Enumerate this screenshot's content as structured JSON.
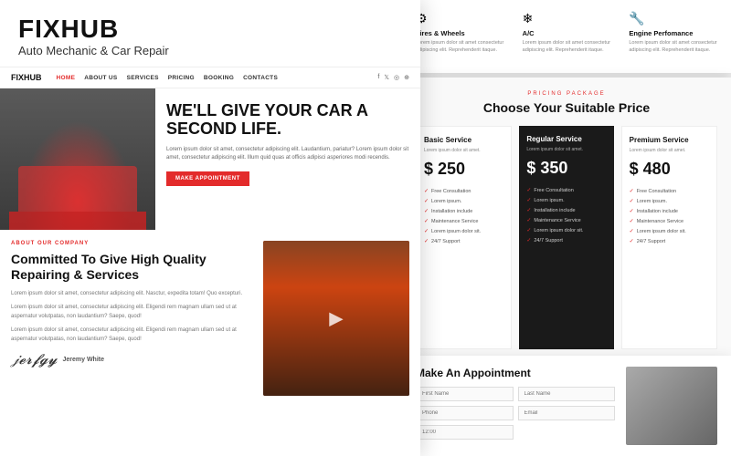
{
  "brand": {
    "title": "FIXHUB",
    "subtitle": "Auto Mechanic & Car Repair"
  },
  "nav": {
    "logo": "FIXHUB",
    "items": [
      "HOME",
      "ABOUT US",
      "SERVICES",
      "PRICING",
      "BOOKING",
      "CONTACTS"
    ]
  },
  "hero": {
    "headline": "WE'LL GIVE YOUR CAR A SECOND LIFE.",
    "description": "Lorem ipsum dolor sit amet, consectetur adipiscing elit. Laudantium, pariatur? Lorem ipsum dolor sit amet, consectetur adipiscing elit. Illum quid quas at officis adipisci asperiores modi recendis.",
    "button_label": "MAKE APPOINTMENT"
  },
  "about": {
    "label": "ABOUT OUR COMPANY",
    "title": "Committed To Give High Quality Repairing & Services",
    "desc1": "Lorem ipsum dolor sit amet, consectetur adipiscing elit. Nasctur, expedita totam! Quo excepturi.",
    "desc2": "Lorem ipsum dolor sit amet, consectetur adipiscing elit. Eligendi rem magnam ullam sed ut at aspernatur volutpatas, non laudantium? Saepe, quod!",
    "desc3": "Lorem ipsum dolor sit amet, consectetur adipiscing elit. Eligendi rem magnam ullam sed ut at aspernatur volutpatas, non laudantium? Saepe, quod!",
    "signature": "Jeremy White",
    "signature_script": "Jeremy White"
  },
  "services": [
    {
      "icon": "⚙",
      "name": "Tires & Wheels",
      "desc": "Lorem ipsum dolor sit amet consectetur adipiscing elit. Reprehenderit itaque."
    },
    {
      "icon": "❄",
      "name": "A/C",
      "desc": "Lorem ipsum dolor sit amet consectetur adipiscing elit. Reprehenderit itaque."
    },
    {
      "icon": "🔧",
      "name": "Engine Perfomance",
      "desc": "Lorem ipsum dolor sit amet consectetur adipiscing elit. Reprehenderit itaque."
    }
  ],
  "pricing": {
    "label": "PRICING PACKAGE",
    "title": "Choose Your Suitable Price",
    "plans": [
      {
        "name": "Basic Service",
        "price": "$ 250",
        "desc": "Lorem ipsum dolor sit amet.",
        "featured": false,
        "features": [
          "Free Consultation",
          "Lorem ipsum.",
          "Installation include",
          "Maintenance Service",
          "Lorem ipsum dolor sit.",
          "24/7 Support"
        ]
      },
      {
        "name": "Regular Service",
        "price": "$ 350",
        "desc": "Lorem ipsum dolor sit amet.",
        "featured": true,
        "features": [
          "Free Consultation",
          "Lorem ipsum.",
          "Installation include",
          "Maintenance Service",
          "Lorem ipsum dolor sit.",
          "24/7 Support"
        ]
      },
      {
        "name": "Premium Service",
        "price": "$ 480",
        "desc": "Lorem ipsum dolor sit amet.",
        "featured": false,
        "features": [
          "Free Consultation",
          "Lorem ipsum.",
          "Installation include",
          "Maintenance Service",
          "Lorem ipsum dolor sit.",
          "24/7 Support"
        ]
      }
    ]
  },
  "booking": {
    "title": "ppointment",
    "fields": [
      "Last Name",
      "Email",
      "12:00"
    ]
  }
}
